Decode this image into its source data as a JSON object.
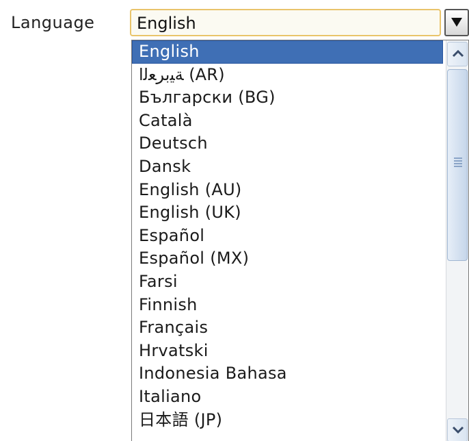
{
  "language_label": "Language",
  "select": {
    "value": "English"
  },
  "icons": {
    "dropdown": "triangle-down",
    "scroll_up": "chevron-up",
    "scroll_down": "chevron-down"
  },
  "options": [
    "English",
    "ﺔﻴﺑﺮﻌﻟا (AR)",
    "Български (BG)",
    "Català",
    "Deutsch",
    "Dansk",
    "English (AU)",
    "English (UK)",
    "Español",
    "Español (MX)",
    "Farsi",
    "Finnish",
    "Français",
    "Hrvatski",
    "Indonesia Bahasa",
    "Italiano",
    "日本語 (JP)"
  ],
  "selected_index": 0,
  "colors": {
    "selection": "#3f6fb5",
    "select_border": "#e9c46a"
  }
}
